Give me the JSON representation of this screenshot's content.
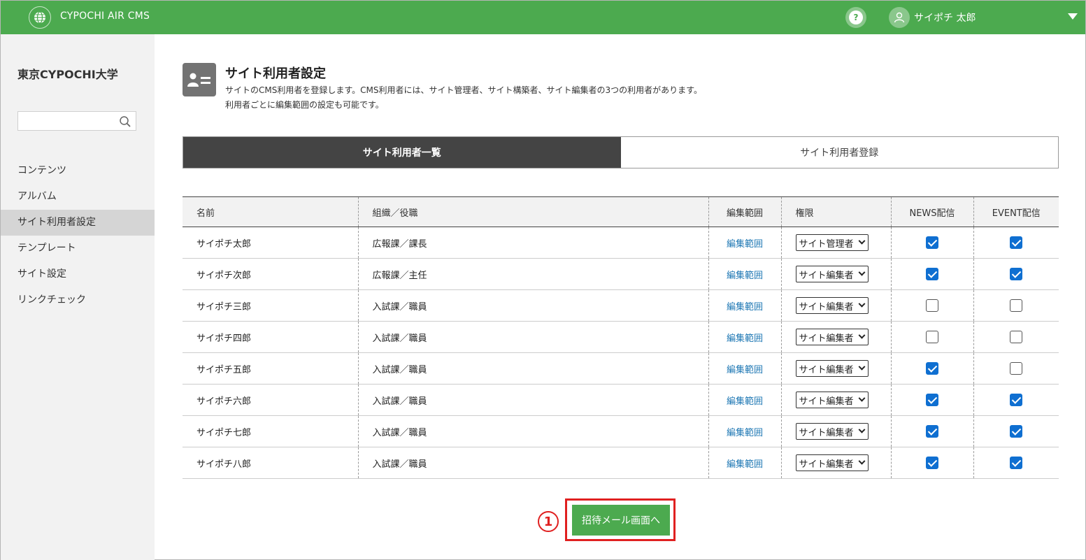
{
  "header": {
    "app_title": "CYPOCHI AIR CMS",
    "help_label": "?",
    "user_name": "サイポチ 太郎",
    "brand_color": "#4caa4f"
  },
  "sidebar": {
    "org_name": "東京CYPOCHI大学",
    "search_placeholder": "",
    "items": [
      {
        "label": "コンテンツ",
        "active": false
      },
      {
        "label": "アルバム",
        "active": false
      },
      {
        "label": "サイト利用者設定",
        "active": true
      },
      {
        "label": "テンプレート",
        "active": false
      },
      {
        "label": "サイト設定",
        "active": false
      },
      {
        "label": "リンクチェック",
        "active": false
      }
    ]
  },
  "page": {
    "title": "サイト利用者設定",
    "description_line1": "サイトのCMS利用者を登録します。CMS利用者には、サイト管理者、サイト構築者、サイト編集者の3つの利用者があります。",
    "description_line2": "利用者ごとに編集範囲の設定も可能です。"
  },
  "tabs": [
    {
      "label": "サイト利用者一覧",
      "active": true
    },
    {
      "label": "サイト利用者登録",
      "active": false
    }
  ],
  "table": {
    "headers": {
      "name": "名前",
      "org": "組織／役職",
      "scope": "編集範囲",
      "role": "権限",
      "news": "NEWS配信",
      "event": "EVENT配信"
    },
    "rows": [
      {
        "name": "サイポチ太郎",
        "org": "広報課／課長",
        "scope": "編集範囲",
        "role": "サイト管理者",
        "news": true,
        "event": true
      },
      {
        "name": "サイポチ次郎",
        "org": "広報課／主任",
        "scope": "編集範囲",
        "role": "サイト編集者",
        "news": true,
        "event": true
      },
      {
        "name": "サイポチ三郎",
        "org": "入試課／職員",
        "scope": "編集範囲",
        "role": "サイト編集者",
        "news": false,
        "event": false
      },
      {
        "name": "サイポチ四郎",
        "org": "入試課／職員",
        "scope": "編集範囲",
        "role": "サイト編集者",
        "news": false,
        "event": false
      },
      {
        "name": "サイポチ五郎",
        "org": "入試課／職員",
        "scope": "編集範囲",
        "role": "サイト編集者",
        "news": true,
        "event": false
      },
      {
        "name": "サイポチ六郎",
        "org": "入試課／職員",
        "scope": "編集範囲",
        "role": "サイト編集者",
        "news": true,
        "event": true
      },
      {
        "name": "サイポチ七郎",
        "org": "入試課／職員",
        "scope": "編集範囲",
        "role": "サイト編集者",
        "news": true,
        "event": true
      },
      {
        "name": "サイポチ八郎",
        "org": "入試課／職員",
        "scope": "編集範囲",
        "role": "サイト編集者",
        "news": true,
        "event": true
      }
    ]
  },
  "invite": {
    "marker": "1",
    "button_label": "招待メール画面へ",
    "highlight_color": "#e02020"
  }
}
